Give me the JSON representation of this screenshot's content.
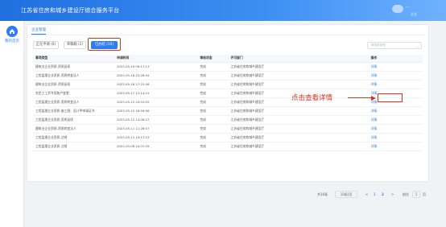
{
  "header": {
    "title": "江苏省住房和城乡建设厅综合服务平台",
    "username": "—",
    "user_sub": "企业"
  },
  "sidebar": {
    "home_label": "我的首页"
  },
  "panel": {
    "top_tab": "企业管理",
    "sub_tabs": [
      {
        "label": "正在申请 (6)"
      },
      {
        "label": "草稿箱 (2)"
      },
      {
        "label": "已办结 (16)"
      }
    ],
    "search_placeholder": "请选择类型"
  },
  "table": {
    "headers": [
      "事项类型",
      "申请时间",
      "审核状态",
      "许可部门",
      "操作"
    ],
    "rows": [
      [
        "建筑业企业资质-资质延续",
        "2023-05-19 09:17:13",
        "完成",
        "江苏省住房和城乡建设厅",
        "详情"
      ],
      [
        "工程监理企业资质-资质转变法人",
        "2023-05-18 15:28:44",
        "完成",
        "江苏省住房和城乡建设厅",
        "详情"
      ],
      [
        "建筑业企业资质-资质延续",
        "2023-05-18 17:23:46",
        "完成",
        "江苏省住房和城乡建设厅",
        "详情"
      ],
      [
        "农民工工资专用账户变更",
        "2023-05-17 12:14:15",
        "完成",
        "江苏省住房和城乡建设厅",
        "详情"
      ],
      [
        "工程监理企业资质-资质转变法人",
        "2023-05-15 20:01:05",
        "完成",
        "江苏省住房和城乡建设厅",
        "详情"
      ],
      [
        "工程监理企业资质-施工图、设计甲申请证书",
        "2023-05-15 16:59:56",
        "完成",
        "江苏省住房和城乡建设厅",
        "详情"
      ],
      [
        "工程监理企业资质-资质延续",
        "2023-05-12 14:06:27",
        "完成",
        "江苏省住房和城乡建设厅",
        "详情"
      ],
      [
        "建筑业企业资质-资质转变法人",
        "2023-05-11 11:28:07",
        "完成",
        "江苏省住房和城乡建设厅",
        "详情"
      ],
      [
        "工程监理企业资质-注销",
        "2023-05-11 10:17:23",
        "完成",
        "江苏省住房和城乡建设厅",
        "详情"
      ],
      [
        "工程监理企业资质-注销",
        "2023-05-08 10:07:59",
        "完成",
        "江苏省住房和城乡建设厅",
        "详情"
      ]
    ]
  },
  "annotation": {
    "text": "点击查看详情"
  },
  "pager": {
    "total": "共16条",
    "page_size": "10条/页",
    "prev": "<",
    "pages": [
      "1",
      "2"
    ],
    "current_page": "2",
    "next": ">",
    "goto_label": "前往",
    "goto_value": "1",
    "page_unit": "页"
  },
  "colors": {
    "primary": "#2e7cf6",
    "annotation": "#e0301e"
  }
}
